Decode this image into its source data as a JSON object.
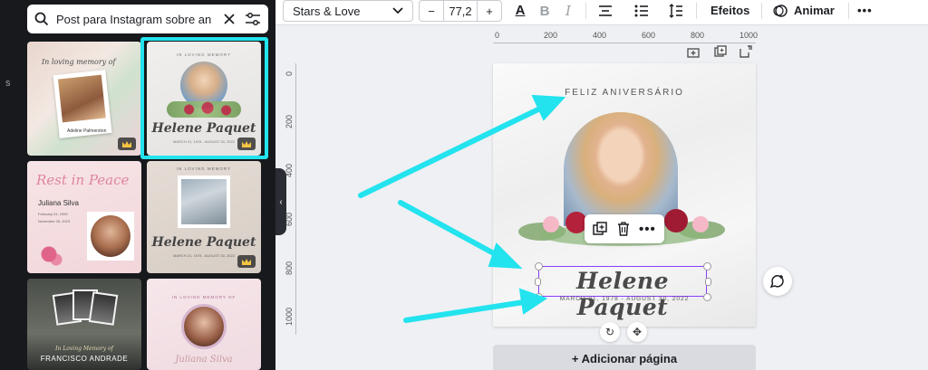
{
  "search": {
    "query": "Post para Instagram sobre an",
    "icon": "search-icon",
    "clear_icon": "close-icon",
    "filter_icon": "filter-icon"
  },
  "templates": [
    {
      "script": "In loving memory of",
      "name": "Adeline Palmerston"
    },
    {
      "label": "IN LOVING MEMORY",
      "name": "Helene Paquet",
      "dates": "MARCH 21, 1978 - AUGUST 30, 2022"
    },
    {
      "title": "Rest in Peace",
      "name": "Juliana Silva",
      "line1": "February 01, 1990",
      "line2": "November 05, 2023"
    },
    {
      "label": "IN LOVING MEMORY",
      "name": "Helene Paquet",
      "dates": "MARCH 21, 1978 - AUGUST 30, 2022"
    },
    {
      "script": "In Loving Memory of",
      "name": "FRANCISCO ANDRADE"
    },
    {
      "label": "IN LOVING MEMORY OF",
      "name": "Juliana Silva"
    }
  ],
  "toolbar": {
    "font": "Stars & Love",
    "size_minus": "−",
    "size": "77,2",
    "size_plus": "+",
    "text_color_icon": "A",
    "bold": "B",
    "italic": "I",
    "effects": "Efeitos",
    "animate": "Animar",
    "more": "•••"
  },
  "ruler": {
    "top": [
      "0",
      "200",
      "400",
      "600",
      "800",
      "1000"
    ],
    "left": [
      "0",
      "200",
      "400",
      "600",
      "800",
      "1000"
    ]
  },
  "canvas": {
    "greeting": "FELIZ ANIVERSÁRIO",
    "name": "Helene Paquet",
    "dates": "MARCH 21, 1978 - AUGUST 30, 2022"
  },
  "context_menu": {
    "duplicate_icon": "duplicate-icon",
    "delete_icon": "trash-icon",
    "more": "•••"
  },
  "add_page": "+ Adicionar página",
  "colors": {
    "accent": "#8b3dff",
    "highlight": "#22e3ee",
    "panel": "#17191c"
  }
}
